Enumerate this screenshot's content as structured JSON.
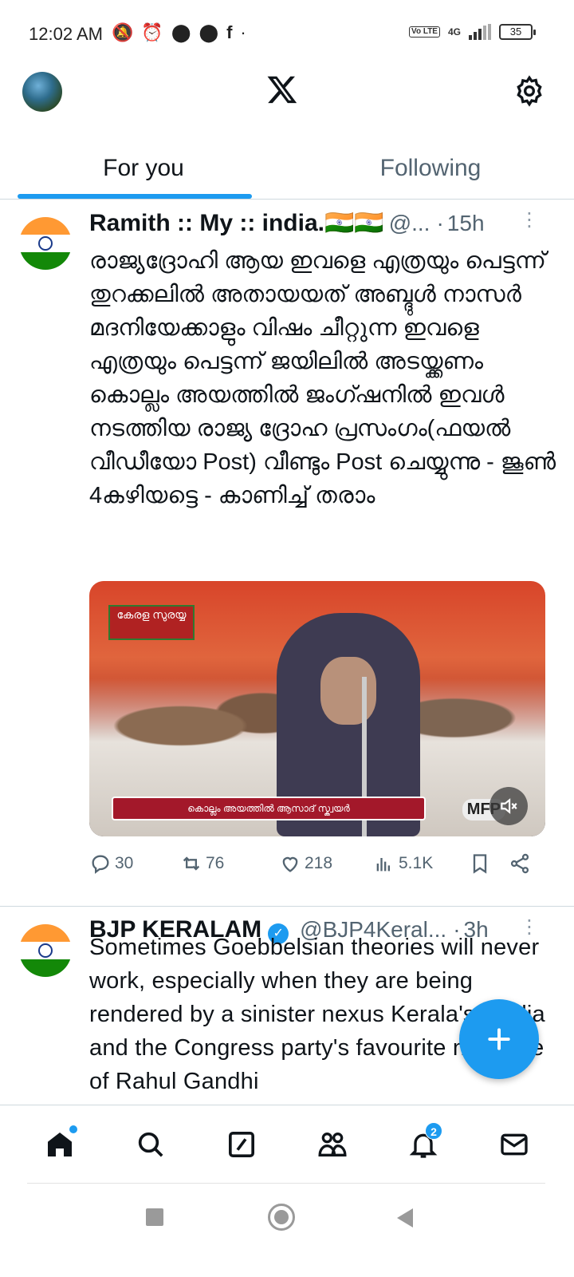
{
  "status_bar": {
    "time": "12:02 AM",
    "left_icons": [
      "mute-icon",
      "alarm-icon",
      "circle-icon",
      "circle-icon",
      "facebook-icon",
      "dot-icon"
    ],
    "network": "4G",
    "battery": "35"
  },
  "header": {
    "logo": "x-logo",
    "settings_icon": "gear-icon"
  },
  "tabs": [
    {
      "label": "For you",
      "active": true
    },
    {
      "label": "Following",
      "active": false
    }
  ],
  "posts": [
    {
      "name": "Ramith :: My :: india.🇮🇳🇮🇳",
      "handle": "@...",
      "time": "15h",
      "verified": false,
      "text": "രാജ്യദ്രോഹി ആയ ഇവളെ എത്രയും പെട്ടന്ന് തുറക്കലിൽ അതായയത് അബ്ദുൾ നാസർ മദനിയേക്കാളും വിഷം ചീറ്റുന്ന ഇവളെ എത്രയും പെട്ടന്ന് ജയിലിൽ അടയ്ക്കണം കൊല്ലം അയത്തിൽ ജംഗ്ഷനിൽ ഇവൾ നടത്തിയ രാജ്യ ദ്രോഹ പ്രസംഗം(ഫയൽ വീഡീയോ Post) വീണ്ടും Post ചെയ്യുന്നു - ജൂൺ 4കഴിയട്ടെ - കാണിച്ച് തരാം",
      "media": {
        "banner_text": "കേരള സുരയ്യ",
        "caption": "കൊല്ലം അയത്തിൽ ആസാദ് സ്ക്വയർ",
        "channel_logo": "MFP"
      },
      "stats": {
        "replies": "30",
        "reposts": "76",
        "likes": "218",
        "views": "5.1K"
      }
    },
    {
      "name": "BJP KERALAM",
      "handle": "@BJP4Keral...",
      "time": "3h",
      "verified": true,
      "text": "Sometimes Goebbelsian theories will never  work, especially when they are being rendered by a sinister nexus Kerala's media and the Congress party's favourite narrative of Rahul Gandhi"
    }
  ],
  "fab": {
    "icon": "plus-icon"
  },
  "bottom_nav": {
    "items": [
      "home-icon",
      "search-icon",
      "grok-icon",
      "communities-icon",
      "notifications-icon",
      "messages-icon"
    ],
    "notification_count": "2"
  },
  "colors": {
    "accent": "#1d9bf0",
    "text": "#0f1419",
    "muted": "#536471"
  }
}
